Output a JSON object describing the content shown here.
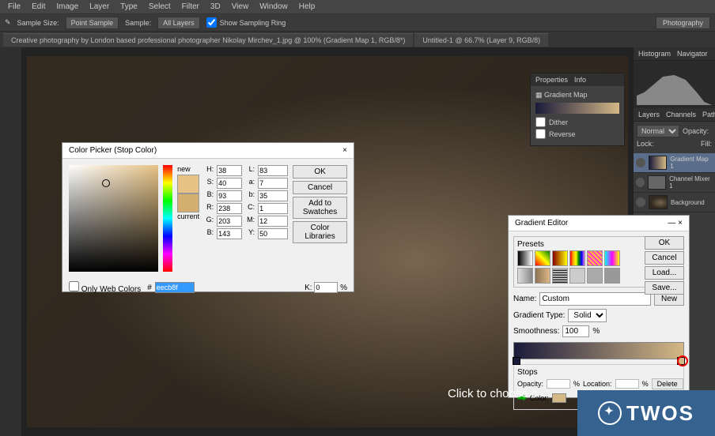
{
  "menu": [
    "File",
    "Edit",
    "Image",
    "Layer",
    "Type",
    "Select",
    "Filter",
    "3D",
    "View",
    "Window",
    "Help"
  ],
  "options": {
    "sample_size_label": "Sample Size:",
    "sample_size_value": "Point Sample",
    "sample_label": "Sample:",
    "sample_value": "All Layers",
    "show_ring": "Show Sampling Ring",
    "right_btn": "Photography"
  },
  "tabs": {
    "tab1": "Creative photography by London based professional photographer Nikolay Mirchev_1.jpg @ 100% (Gradient Map 1, RGB/8*)",
    "tab2": "Untitled-1 @ 66.7% (Layer 9, RGB/8)"
  },
  "props": {
    "tab1": "Properties",
    "tab2": "Info",
    "title": "Gradient Map",
    "dither": "Dither",
    "reverse": "Reverse"
  },
  "right": {
    "histo_tab1": "Histogram",
    "histo_tab2": "Navigator",
    "layers_tab1": "Layers",
    "layers_tab2": "Channels",
    "layers_tab3": "Paths",
    "blend_mode": "Normal",
    "opacity_label": "Opacity:",
    "lock_label": "Lock:",
    "fill_label": "Fill:",
    "layer1": "Gradient Map 1",
    "layer2": "Channel Mixer 1",
    "layer3": "Background"
  },
  "cp": {
    "title": "Color Picker (Stop Color)",
    "new_label": "new",
    "cur_label": "current",
    "btn_ok": "OK",
    "btn_cancel": "Cancel",
    "btn_add": "Add to Swatches",
    "btn_lib": "Color Libraries",
    "only_web": "Only Web Colors",
    "values": {
      "H": "38",
      "S": "40",
      "B": "93",
      "R": "238",
      "G": "203",
      "B2": "143",
      "L": "83",
      "a": "7",
      "b": "35",
      "C": "1",
      "M": "12",
      "Y": "50",
      "K": "0"
    },
    "hex": "eecb8f"
  },
  "ge": {
    "title": "Gradient Editor",
    "presets_label": "Presets",
    "btn_ok": "OK",
    "btn_cancel": "Cancel",
    "btn_load": "Load...",
    "btn_save": "Save...",
    "name_label": "Name:",
    "name_value": "Custom",
    "btn_new": "New",
    "type_label": "Gradient Type:",
    "type_value": "Solid",
    "smooth_label": "Smoothness:",
    "smooth_value": "100",
    "pct": "%",
    "stops_label": "Stops",
    "opacity_label": "Opacity:",
    "location_label": "Location:",
    "delete": "Delete",
    "color_label": "Color:"
  },
  "footer_text": "Click to choose c",
  "twos": "TWOS"
}
